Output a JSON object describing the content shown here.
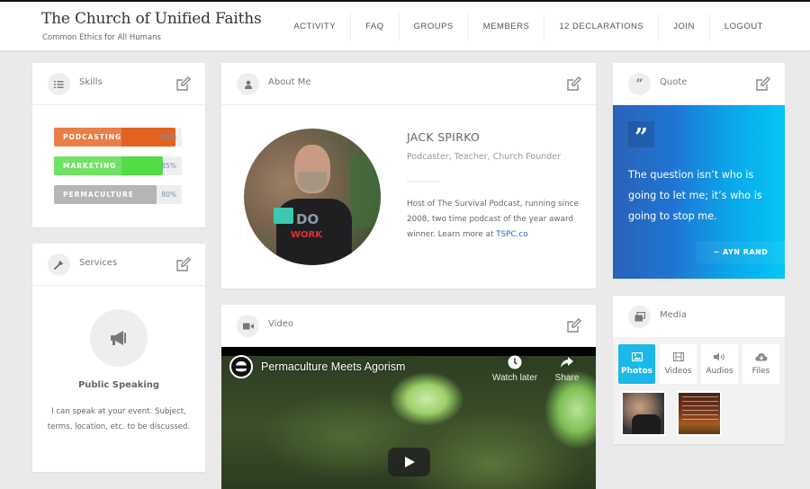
{
  "site": {
    "title": "The Church of Unified Faiths",
    "tagline": "Common Ethics for All Humans"
  },
  "nav": {
    "items": [
      {
        "label": "ACTIVITY"
      },
      {
        "label": "FAQ"
      },
      {
        "label": "GROUPS"
      },
      {
        "label": "MEMBERS"
      },
      {
        "label": "12 DECLARATIONS"
      },
      {
        "label": "JOIN"
      },
      {
        "label": "LOGOUT"
      }
    ]
  },
  "skills": {
    "title": "Skills",
    "icon": "list-icon",
    "items": [
      {
        "label": "PODCASTING",
        "percent_label": "95%",
        "percent": 95,
        "color": "#e4621f"
      },
      {
        "label": "MARKETING",
        "percent_label": "85%",
        "percent": 85,
        "color": "#52dc45"
      },
      {
        "label": "PERMACULTURE",
        "percent_label": "80%",
        "percent": 80,
        "color": "#b5b5b5"
      }
    ]
  },
  "services": {
    "title": "Services",
    "icon": "wrench-icon",
    "service_icon": "megaphone-icon",
    "service_name": "Public Speaking",
    "service_desc": "I can speak at your event. Subject, terms, location, etc. to be discussed."
  },
  "about": {
    "title": "About Me",
    "icon": "user-icon",
    "name": "JACK SPIRKO",
    "role": "Podcaster, Teacher, Church Founder",
    "bio": "Host of The Survival Podcast, running since 2008, two time podcast of the year award winner.  Learn more at ",
    "link_text": "TSPC.co",
    "link_color": "#2b62c6",
    "avatar_shirt_line1": "DO",
    "avatar_shirt_line2": "WORK"
  },
  "video": {
    "title": "Video",
    "icon": "video-camera-icon",
    "video_title": "Permaculture Meets Agorism",
    "watch_later_label": "Watch later",
    "share_label": "Share"
  },
  "quote": {
    "title": "Quote",
    "icon": "quote-icon",
    "text": "The question isn’t who is going to let me; it’s who is going to stop me.",
    "author": "~ AYN RAND",
    "gradient_start": "#2a62b8",
    "gradient_end": "#04c6f6"
  },
  "media": {
    "title": "Media",
    "icon": "gallery-icon",
    "accent": "#1bb8ea",
    "tabs": [
      {
        "label": "Photos",
        "icon": "image-icon",
        "active": true
      },
      {
        "label": "Videos",
        "icon": "film-icon",
        "active": false
      },
      {
        "label": "Audios",
        "icon": "speaker-icon",
        "active": false
      },
      {
        "label": "Files",
        "icon": "cloud-download-icon",
        "active": false
      }
    ]
  }
}
